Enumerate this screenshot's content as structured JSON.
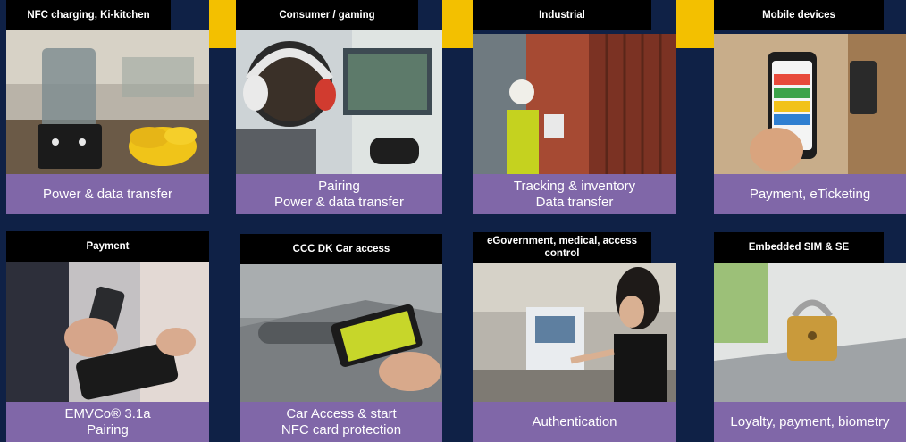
{
  "colors": {
    "background": "#0f2146",
    "accent_yellow": "#f3c000",
    "header_black": "#000000",
    "caption_purple": "#8067a8"
  },
  "tiles": [
    {
      "title": "NFC charging, Ki-kitchen",
      "caption_lines": [
        "Power & data transfer"
      ],
      "image": "kitchen-blender-bananas-photo"
    },
    {
      "title": "Consumer / gaming",
      "caption_lines": [
        "Pairing",
        "Power & data transfer"
      ],
      "image": "gamer-headphones-controller-photo"
    },
    {
      "title": "Industrial",
      "caption_lines": [
        "Tracking & inventory",
        "Data transfer"
      ],
      "image": "worker-shipping-containers-photo"
    },
    {
      "title": "Mobile devices",
      "caption_lines": [
        "Payment, eTicketing"
      ],
      "image": "phone-wallet-door-lock-photo"
    },
    {
      "title": "Payment",
      "caption_lines": [
        "EMVCo® 3.1a",
        "Pairing"
      ],
      "image": "phone-payment-terminal-photo"
    },
    {
      "title": "CCC DK Car access",
      "caption_lines": [
        "Car Access & start",
        "NFC card protection"
      ],
      "image": "phone-car-door-handle-photo"
    },
    {
      "title": "eGovernment, medical, access control",
      "caption_lines": [
        "Authentication"
      ],
      "image": "woman-kiosk-card-reader-photo"
    },
    {
      "title": "Embedded SIM & SE",
      "caption_lines": [
        "Loyalty, payment, biometry"
      ],
      "image": "padlock-on-laptop-photo"
    }
  ]
}
